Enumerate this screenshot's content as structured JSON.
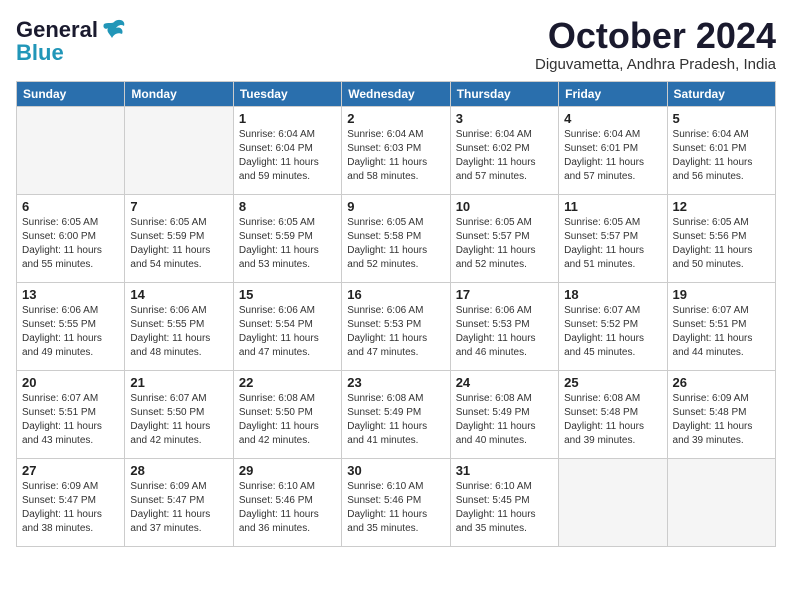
{
  "logo": {
    "general": "General",
    "blue": "Blue"
  },
  "title": "October 2024",
  "subtitle": "Diguvametta, Andhra Pradesh, India",
  "days_header": [
    "Sunday",
    "Monday",
    "Tuesday",
    "Wednesday",
    "Thursday",
    "Friday",
    "Saturday"
  ],
  "weeks": [
    [
      {
        "day": "",
        "info": ""
      },
      {
        "day": "",
        "info": ""
      },
      {
        "day": "1",
        "info": "Sunrise: 6:04 AM\nSunset: 6:04 PM\nDaylight: 11 hours\nand 59 minutes."
      },
      {
        "day": "2",
        "info": "Sunrise: 6:04 AM\nSunset: 6:03 PM\nDaylight: 11 hours\nand 58 minutes."
      },
      {
        "day": "3",
        "info": "Sunrise: 6:04 AM\nSunset: 6:02 PM\nDaylight: 11 hours\nand 57 minutes."
      },
      {
        "day": "4",
        "info": "Sunrise: 6:04 AM\nSunset: 6:01 PM\nDaylight: 11 hours\nand 57 minutes."
      },
      {
        "day": "5",
        "info": "Sunrise: 6:04 AM\nSunset: 6:01 PM\nDaylight: 11 hours\nand 56 minutes."
      }
    ],
    [
      {
        "day": "6",
        "info": "Sunrise: 6:05 AM\nSunset: 6:00 PM\nDaylight: 11 hours\nand 55 minutes."
      },
      {
        "day": "7",
        "info": "Sunrise: 6:05 AM\nSunset: 5:59 PM\nDaylight: 11 hours\nand 54 minutes."
      },
      {
        "day": "8",
        "info": "Sunrise: 6:05 AM\nSunset: 5:59 PM\nDaylight: 11 hours\nand 53 minutes."
      },
      {
        "day": "9",
        "info": "Sunrise: 6:05 AM\nSunset: 5:58 PM\nDaylight: 11 hours\nand 52 minutes."
      },
      {
        "day": "10",
        "info": "Sunrise: 6:05 AM\nSunset: 5:57 PM\nDaylight: 11 hours\nand 52 minutes."
      },
      {
        "day": "11",
        "info": "Sunrise: 6:05 AM\nSunset: 5:57 PM\nDaylight: 11 hours\nand 51 minutes."
      },
      {
        "day": "12",
        "info": "Sunrise: 6:05 AM\nSunset: 5:56 PM\nDaylight: 11 hours\nand 50 minutes."
      }
    ],
    [
      {
        "day": "13",
        "info": "Sunrise: 6:06 AM\nSunset: 5:55 PM\nDaylight: 11 hours\nand 49 minutes."
      },
      {
        "day": "14",
        "info": "Sunrise: 6:06 AM\nSunset: 5:55 PM\nDaylight: 11 hours\nand 48 minutes."
      },
      {
        "day": "15",
        "info": "Sunrise: 6:06 AM\nSunset: 5:54 PM\nDaylight: 11 hours\nand 47 minutes."
      },
      {
        "day": "16",
        "info": "Sunrise: 6:06 AM\nSunset: 5:53 PM\nDaylight: 11 hours\nand 47 minutes."
      },
      {
        "day": "17",
        "info": "Sunrise: 6:06 AM\nSunset: 5:53 PM\nDaylight: 11 hours\nand 46 minutes."
      },
      {
        "day": "18",
        "info": "Sunrise: 6:07 AM\nSunset: 5:52 PM\nDaylight: 11 hours\nand 45 minutes."
      },
      {
        "day": "19",
        "info": "Sunrise: 6:07 AM\nSunset: 5:51 PM\nDaylight: 11 hours\nand 44 minutes."
      }
    ],
    [
      {
        "day": "20",
        "info": "Sunrise: 6:07 AM\nSunset: 5:51 PM\nDaylight: 11 hours\nand 43 minutes."
      },
      {
        "day": "21",
        "info": "Sunrise: 6:07 AM\nSunset: 5:50 PM\nDaylight: 11 hours\nand 42 minutes."
      },
      {
        "day": "22",
        "info": "Sunrise: 6:08 AM\nSunset: 5:50 PM\nDaylight: 11 hours\nand 42 minutes."
      },
      {
        "day": "23",
        "info": "Sunrise: 6:08 AM\nSunset: 5:49 PM\nDaylight: 11 hours\nand 41 minutes."
      },
      {
        "day": "24",
        "info": "Sunrise: 6:08 AM\nSunset: 5:49 PM\nDaylight: 11 hours\nand 40 minutes."
      },
      {
        "day": "25",
        "info": "Sunrise: 6:08 AM\nSunset: 5:48 PM\nDaylight: 11 hours\nand 39 minutes."
      },
      {
        "day": "26",
        "info": "Sunrise: 6:09 AM\nSunset: 5:48 PM\nDaylight: 11 hours\nand 39 minutes."
      }
    ],
    [
      {
        "day": "27",
        "info": "Sunrise: 6:09 AM\nSunset: 5:47 PM\nDaylight: 11 hours\nand 38 minutes."
      },
      {
        "day": "28",
        "info": "Sunrise: 6:09 AM\nSunset: 5:47 PM\nDaylight: 11 hours\nand 37 minutes."
      },
      {
        "day": "29",
        "info": "Sunrise: 6:10 AM\nSunset: 5:46 PM\nDaylight: 11 hours\nand 36 minutes."
      },
      {
        "day": "30",
        "info": "Sunrise: 6:10 AM\nSunset: 5:46 PM\nDaylight: 11 hours\nand 35 minutes."
      },
      {
        "day": "31",
        "info": "Sunrise: 6:10 AM\nSunset: 5:45 PM\nDaylight: 11 hours\nand 35 minutes."
      },
      {
        "day": "",
        "info": ""
      },
      {
        "day": "",
        "info": ""
      }
    ]
  ]
}
